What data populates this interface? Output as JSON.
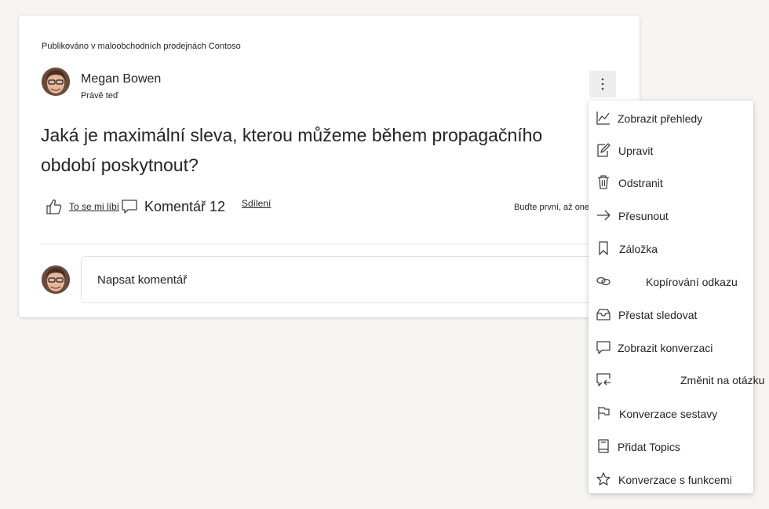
{
  "post": {
    "published_in": "Publikováno v maloobchodních prodejnách Contoso",
    "author_name": "Megan Bowen",
    "timestamp": "Právě teď",
    "question": "Jaká je maximální sleva, kterou můžeme během propagačního období poskytnout?",
    "like_label": "To se mi líbí",
    "comment_label": "Komentář 12",
    "share_label": "Sdílení",
    "first_reply": "Buďte první, až onemocní",
    "reply_placeholder": "Napsat komentář"
  },
  "menu": {
    "items": [
      {
        "label": "Zobrazit přehledy",
        "icon": "chart-icon"
      },
      {
        "label": "Upravit",
        "icon": "edit-icon"
      },
      {
        "label": "Odstranit",
        "icon": "trash-icon"
      },
      {
        "label": "Přesunout",
        "icon": "arrow-right-icon"
      },
      {
        "label": "Záložka",
        "icon": "bookmark-icon"
      },
      {
        "label": "Kopírování odkazu",
        "icon": "link-icon"
      },
      {
        "label": "Přestat sledovat",
        "icon": "inbox-icon"
      },
      {
        "label": "Zobrazit konverzaci",
        "icon": "chat-icon"
      },
      {
        "label": "Změnit na otázku",
        "icon": "chat-swap-icon"
      },
      {
        "label": "Konverzace sestavy",
        "icon": "flag-icon"
      },
      {
        "label": "Přidat Topics",
        "icon": "book-icon"
      },
      {
        "label": "Konverzace s funkcemi",
        "icon": "star-icon"
      }
    ]
  }
}
